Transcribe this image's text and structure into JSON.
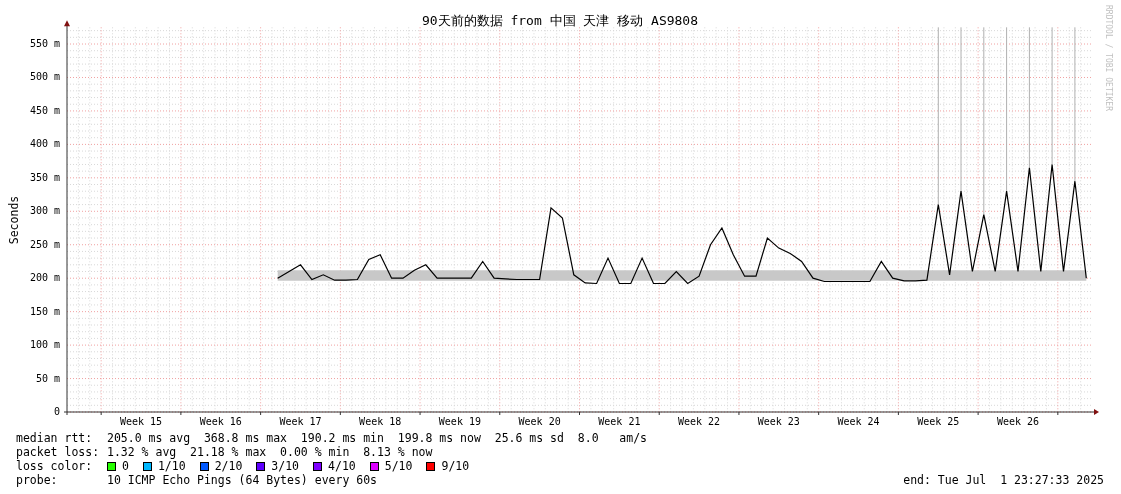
{
  "title": "90天前的数据 from 中国 天津 移动 AS9808",
  "credit": "RRDTOOL / TOBI OETIKER",
  "chart": {
    "chart_data": {
      "type": "line",
      "grid": true,
      "ylabel": "Seconds",
      "ylim": [
        0,
        575
      ],
      "yticks": [
        {
          "value": 0,
          "label": "0"
        },
        {
          "value": 50,
          "label": "50 m"
        },
        {
          "value": 100,
          "label": "100 m"
        },
        {
          "value": 150,
          "label": "150 m"
        },
        {
          "value": 200,
          "label": "200 m"
        },
        {
          "value": 250,
          "label": "250 m"
        },
        {
          "value": 300,
          "label": "300 m"
        },
        {
          "value": 350,
          "label": "350 m"
        },
        {
          "value": 400,
          "label": "400 m"
        },
        {
          "value": 450,
          "label": "450 m"
        },
        {
          "value": 500,
          "label": "500 m"
        },
        {
          "value": 550,
          "label": "550 m"
        }
      ],
      "categories": [
        null,
        null,
        null,
        null,
        null,
        null,
        "Week 15",
        null,
        null,
        null,
        null,
        null,
        null,
        "Week 16",
        null,
        null,
        null,
        null,
        null,
        null,
        "Week 17",
        null,
        null,
        null,
        null,
        null,
        null,
        "Week 18",
        null,
        null,
        null,
        null,
        null,
        null,
        "Week 19",
        null,
        null,
        null,
        null,
        null,
        null,
        "Week 20",
        null,
        null,
        null,
        null,
        null,
        null,
        "Week 21",
        null,
        null,
        null,
        null,
        null,
        null,
        "Week 22",
        null,
        null,
        null,
        null,
        null,
        null,
        "Week 23",
        null,
        null,
        null,
        null,
        null,
        null,
        "Week 24",
        null,
        null,
        null,
        null,
        null,
        null,
        "Week 25",
        null,
        null,
        null,
        null,
        null,
        null,
        "Week 26",
        null,
        null,
        null,
        null,
        null,
        null
      ],
      "series": [
        {
          "color": "#000000",
          "values": [
            null,
            null,
            null,
            null,
            null,
            null,
            null,
            null,
            null,
            null,
            null,
            null,
            null,
            null,
            null,
            null,
            null,
            null,
            200,
            210,
            220,
            198,
            205,
            197,
            197,
            198,
            228,
            235,
            200,
            200,
            212,
            220,
            200,
            200,
            200,
            200,
            225,
            200,
            199,
            198,
            198,
            198,
            305,
            290,
            205,
            193,
            192,
            230,
            192,
            192,
            230,
            192,
            192,
            210,
            192,
            203,
            250,
            275,
            235,
            203,
            203,
            260,
            245,
            237,
            225,
            200,
            195,
            195,
            195,
            195,
            195,
            225,
            200,
            196,
            196,
            197,
            310,
            205,
            330,
            210,
            295,
            210,
            330,
            210,
            365,
            210,
            370,
            210,
            345,
            200
          ]
        }
      ]
    }
  },
  "legend": {
    "rows": [
      {
        "kind": "text",
        "label": "median rtt:",
        "text": "205.0 ms avg  368.8 ms max  190.2 ms min  199.8 ms now  25.6 ms sd  8.0   am/s"
      },
      {
        "kind": "text",
        "label": "packet loss:",
        "text": "1.32 % avg  21.18 % max  0.00 % min  8.13 % now"
      },
      {
        "kind": "colors",
        "label": "loss color:",
        "items": [
          {
            "label": "0",
            "color": "#26ff00"
          },
          {
            "label": "1/10",
            "color": "#00b8ff"
          },
          {
            "label": "2/10",
            "color": "#0059ff"
          },
          {
            "label": "3/10",
            "color": "#5e00ff"
          },
          {
            "label": "4/10",
            "color": "#7e00ff"
          },
          {
            "label": "5/10",
            "color": "#dd00ff"
          },
          {
            "label": "9/10",
            "color": "#ff0000"
          }
        ]
      },
      {
        "kind": "text",
        "label": "probe:",
        "text": "10 ICMP Echo Pings (64 Bytes) every 60s",
        "end": "end: Tue Jul  1 23:27:33 2025"
      }
    ]
  }
}
